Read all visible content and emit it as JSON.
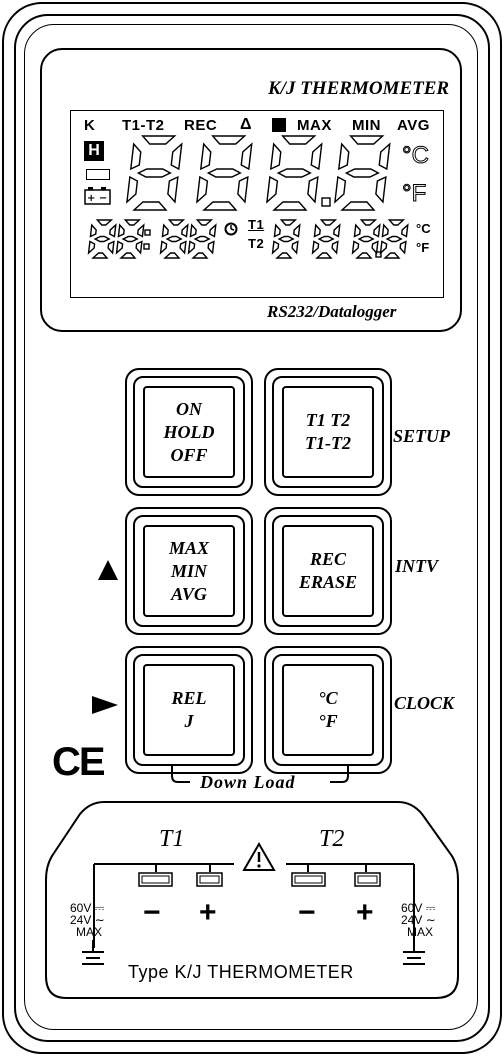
{
  "lcd": {
    "brand": "K/J THERMOMETER",
    "footer": "RS232/Datalogger",
    "indicators": {
      "k": "K",
      "t1t2": "T1-T2",
      "rec": "REC",
      "delta": "Δ",
      "max": "MAX",
      "min": "MIN",
      "avg": "AVG",
      "hold": "H",
      "deg_c": "°C",
      "deg_f": "°F",
      "small_c": "°C",
      "small_f": "°F",
      "t1": "T1",
      "t2": "T2"
    },
    "main_digits": "8.8.8.8",
    "sub_time": "88:88",
    "sub_digits": "888.8"
  },
  "buttons": {
    "power": [
      "ON",
      "HOLD",
      "OFF"
    ],
    "t1t2": [
      "T1 T2",
      "T1-T2"
    ],
    "maxmin": [
      "MAX",
      "MIN",
      "AVG"
    ],
    "rec": [
      "REC",
      "ERASE"
    ],
    "rel": [
      "REL",
      "J"
    ],
    "unit": [
      "°C",
      "°F"
    ]
  },
  "side_labels": {
    "setup": "SETUP",
    "intv": "INTV",
    "clock": "CLOCK"
  },
  "download": "Down Load",
  "ce_mark": "CE",
  "input_panel": {
    "t1": "T1",
    "t2": "T2",
    "rating_left": [
      "60V",
      "24V",
      "MAX"
    ],
    "rating_right": [
      "60V",
      "24V",
      "MAX"
    ],
    "minus": "−",
    "plus": "+",
    "type_label": "Type K/J THERMOMETER"
  }
}
